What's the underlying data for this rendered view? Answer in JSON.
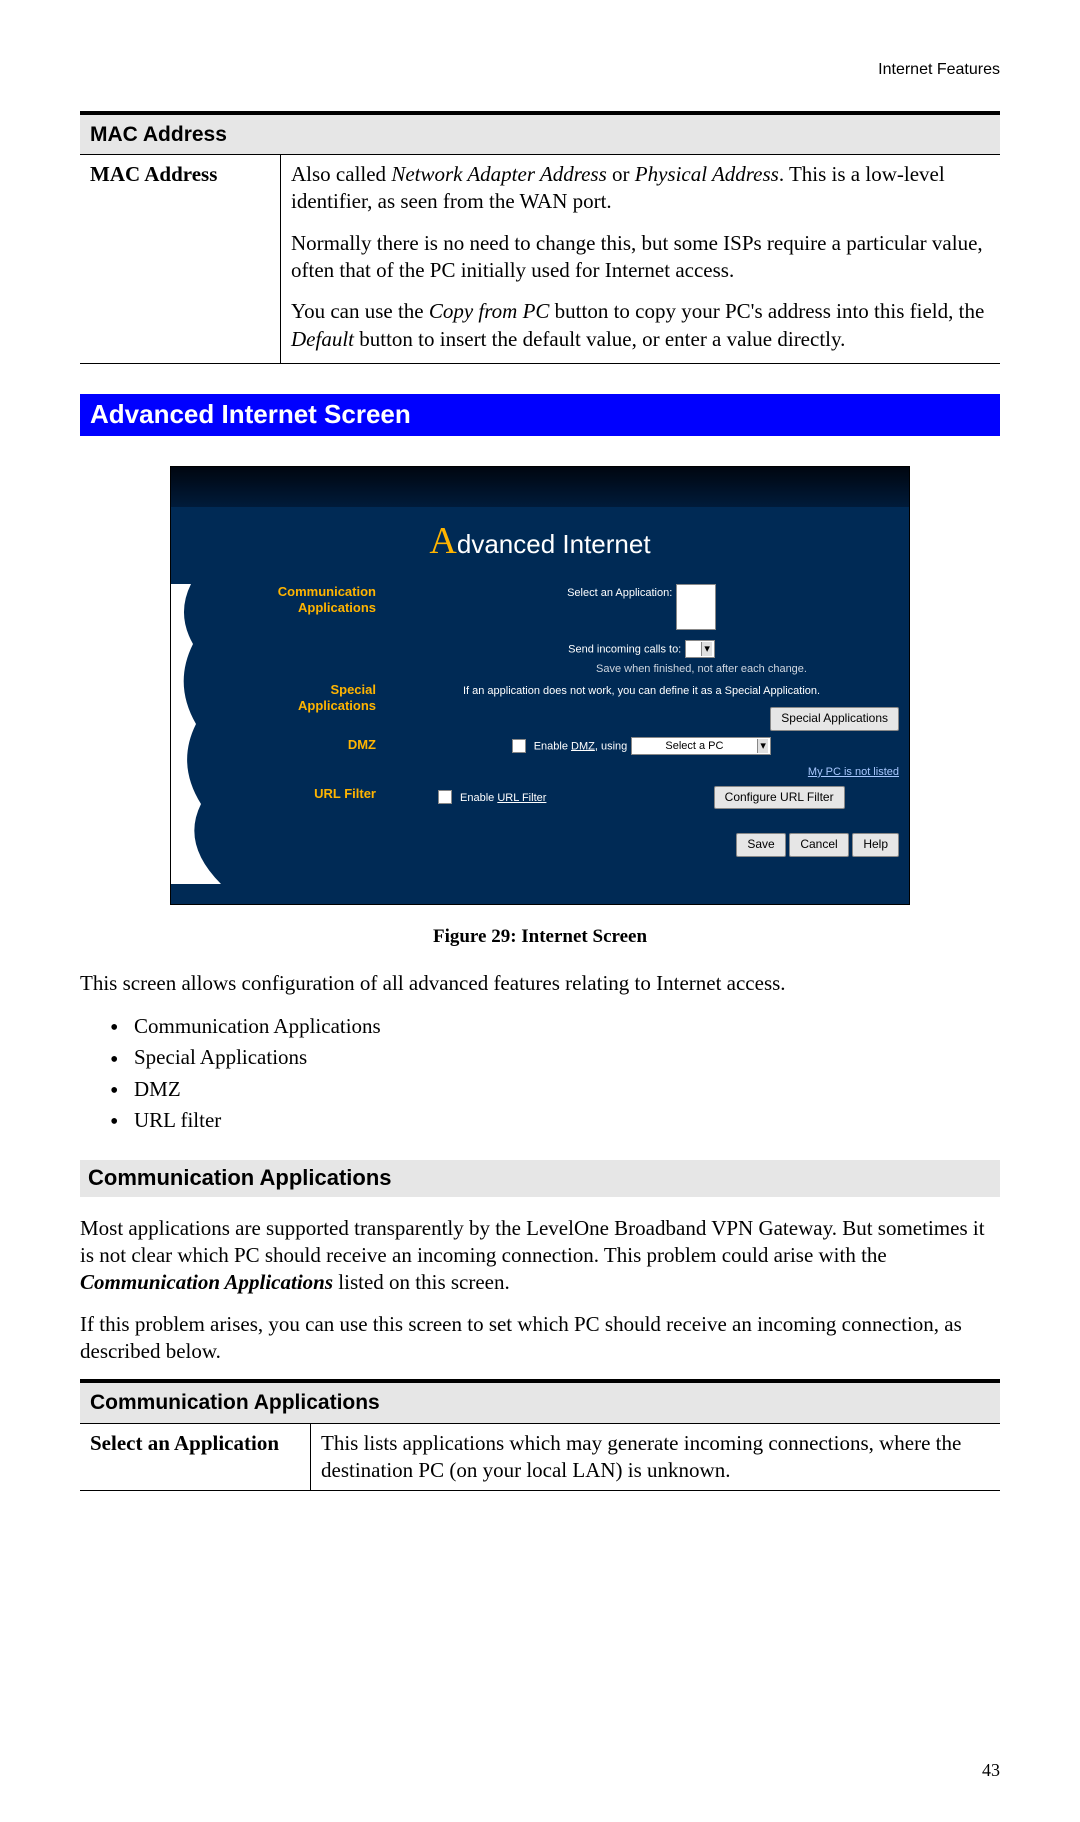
{
  "header_right": "Internet Features",
  "page_number": "43",
  "table_mac": {
    "header": "MAC Address",
    "row_label": "MAC Address",
    "para1_pre": "Also called ",
    "para1_it1": "Network Adapter Address",
    "para1_mid": " or ",
    "para1_it2": "Physical Address",
    "para1_post": ". This is a low-level identifier, as seen from the WAN port.",
    "para2": "Normally there is no need to change this, but some ISPs require a particular value, often that of the PC initially used for Internet access.",
    "para3_pre": "You can use the ",
    "para3_it1": "Copy from PC",
    "para3_mid": " button to copy your PC's address into this field, the ",
    "para3_it2": "Default",
    "para3_post": " button to insert the default value, or enter a value directly."
  },
  "section_bar": "Advanced Internet Screen",
  "ui": {
    "title_rest": "dvanced Internet",
    "comm_apps_label_l1": "Communication",
    "comm_apps_label_l2": "Applications",
    "select_app": "Select an Application:",
    "send_calls": "Send incoming calls to:",
    "save_hint": "Save when finished, not after each change.",
    "special_label_l1": "Special",
    "special_label_l2": "Applications",
    "special_text": "If an application does not work, you can define it as a Special Application.",
    "special_btn": "Special Applications",
    "dmz_label": "DMZ",
    "dmz_enable_pre": "Enable ",
    "dmz_enable_u": "DMZ",
    "dmz_enable_post": ", using",
    "dmz_select_pc": "Select a PC",
    "not_listed": "My PC is not listed",
    "urlf_label": "URL Filter",
    "urlf_enable_pre": "Enable ",
    "urlf_enable_u": "URL Filter",
    "urlf_btn": "Configure URL Filter",
    "save_btn": "Save",
    "cancel_btn": "Cancel",
    "help_btn": "Help"
  },
  "caption": "Figure 29: Internet Screen",
  "intro": "This screen allows configuration of all advanced features relating to Internet access.",
  "bullets": [
    "Communication Applications",
    "Special Applications",
    "DMZ",
    "URL filter"
  ],
  "subhdr": "Communication Applications",
  "p1_pre": "Most applications are supported transparently by the LevelOne Broadband VPN Gateway. But sometimes it is not clear which PC should receive an incoming connection. This problem could arise with the ",
  "p1_bi": "Communication Applications",
  "p1_post": " listed on this screen.",
  "p2": "If this problem arises, you can use this screen to set which PC should receive an incoming connection, as described below.",
  "table_ca": {
    "header": "Communication Applications",
    "row_label": "Select an Application",
    "row_value": "This lists applications which may generate incoming connections, where the destination PC (on your local LAN) is unknown."
  }
}
